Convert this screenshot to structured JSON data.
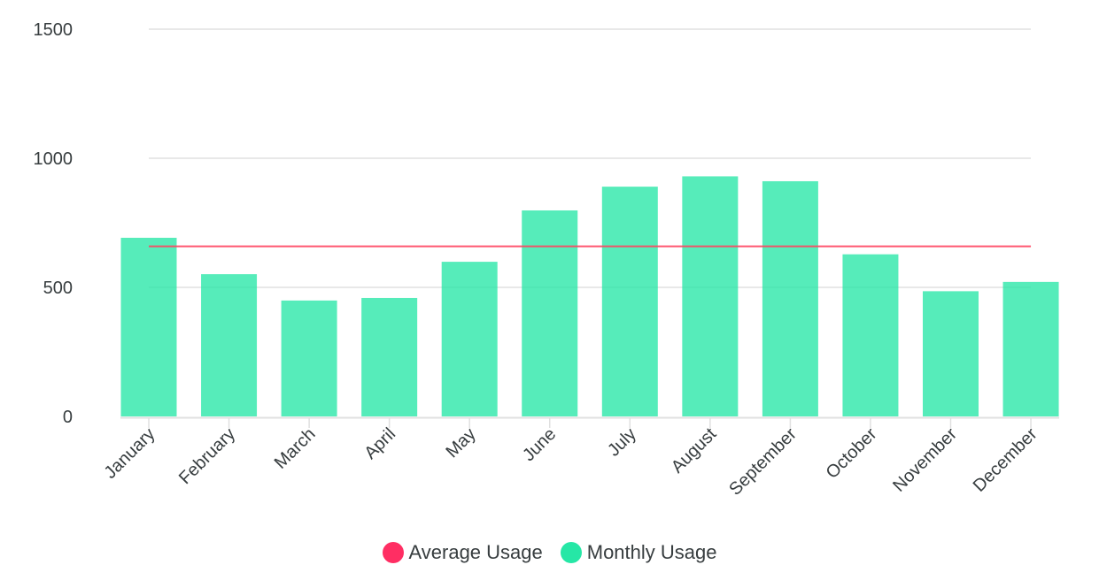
{
  "chart_data": {
    "type": "bar",
    "title": "",
    "xlabel": "",
    "ylabel": "",
    "ylim": [
      0,
      1500
    ],
    "yticks": [
      0,
      500,
      1000,
      1500
    ],
    "ytick_labels": [
      "0",
      "500",
      "1000",
      "1500"
    ],
    "grid": true,
    "legend_position": "bottom-center",
    "categories": [
      "January",
      "February",
      "March",
      "April",
      "May",
      "June",
      "July",
      "August",
      "September",
      "October",
      "November",
      "December"
    ],
    "series": [
      {
        "name": "Monthly Usage",
        "type": "bar",
        "color": "#26e7a6",
        "values": [
          692,
          551,
          449,
          459,
          599,
          798,
          890,
          930,
          911,
          628,
          485,
          521
        ]
      },
      {
        "name": "Average Usage",
        "type": "line",
        "color": "#ff4560",
        "values": [
          659,
          659,
          659,
          659,
          659,
          659,
          659,
          659,
          659,
          659,
          659,
          659
        ]
      }
    ]
  },
  "legend": [
    {
      "label": "Average Usage",
      "color": "#ff2e63"
    },
    {
      "label": "Monthly Usage",
      "color": "#26e7a6"
    }
  ]
}
